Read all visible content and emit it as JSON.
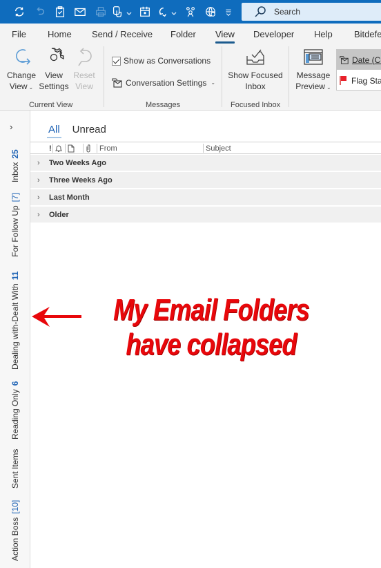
{
  "titlebar": {
    "qat": [
      {
        "name": "send-receive-all-icon",
        "disabled": false
      },
      {
        "name": "undo-icon",
        "disabled": true
      },
      {
        "name": "tasks-icon",
        "disabled": false
      },
      {
        "name": "mail-icon",
        "disabled": false
      },
      {
        "name": "print-icon",
        "disabled": true
      },
      {
        "name": "touch-mode-icon",
        "disabled": false,
        "has_dropdown": true
      },
      {
        "name": "calendar-icon",
        "disabled": false
      },
      {
        "name": "reply-icon",
        "disabled": false,
        "has_dropdown": true
      },
      {
        "name": "people-icon",
        "disabled": false
      },
      {
        "name": "web-icon",
        "disabled": false
      },
      {
        "name": "customize-qat-icon",
        "disabled": false
      }
    ],
    "search_placeholder": "Search"
  },
  "ribbon_tabs": [
    {
      "label": "File",
      "active": false
    },
    {
      "label": "Home",
      "active": false
    },
    {
      "label": "Send / Receive",
      "active": false
    },
    {
      "label": "Folder",
      "active": false
    },
    {
      "label": "View",
      "active": true
    },
    {
      "label": "Developer",
      "active": false
    },
    {
      "label": "Help",
      "active": false
    },
    {
      "label": "Bitdefe",
      "active": false
    }
  ],
  "ribbon": {
    "current_view": {
      "label": "Current View",
      "change_view": {
        "line1": "Change",
        "line2": "View"
      },
      "view_settings": {
        "line1": "View",
        "line2": "Settings"
      },
      "reset_view": {
        "line1": "Reset",
        "line2": "View",
        "disabled": true
      }
    },
    "messages": {
      "label": "Messages",
      "show_as_conversations": {
        "label": "Show as Conversations",
        "checked": true
      },
      "conversation_settings": {
        "label": "Conversation Settings"
      }
    },
    "focused_inbox": {
      "label": "Focused Inbox",
      "show_focused": {
        "line1": "Show Focused",
        "line2": "Inbox"
      }
    },
    "layout": {
      "message_preview": {
        "line1": "Message",
        "line2": "Preview"
      }
    },
    "arrangement": {
      "items": [
        {
          "label": "Date (Co",
          "selected": true
        },
        {
          "label": "Flag Sta",
          "selected": false
        }
      ]
    }
  },
  "folder_pane": {
    "collapsed": true,
    "folders": [
      {
        "name": "Inbox",
        "count": "25",
        "count_style": "bold"
      },
      {
        "name": "For Follow Up",
        "count": "[7]",
        "count_style": "bracket"
      },
      {
        "name": "Dealing with-Dealt With",
        "count": "11",
        "count_style": "bold"
      },
      {
        "name": "Reading Only",
        "count": "6",
        "count_style": "bold"
      },
      {
        "name": "Sent Items",
        "count": "",
        "count_style": "none"
      },
      {
        "name": "Action Boss",
        "count": "[10]",
        "count_style": "bracket"
      }
    ]
  },
  "message_list": {
    "filter_tabs": [
      {
        "label": "All",
        "active": true
      },
      {
        "label": "Unread",
        "active": false
      }
    ],
    "columns": {
      "importance": "!",
      "reminder": "reminder-icon",
      "icon": "document-icon",
      "attachment": "paperclip-icon",
      "from": "From",
      "subject": "Subject"
    },
    "groups": [
      {
        "label": "Two Weeks Ago"
      },
      {
        "label": "Three Weeks Ago"
      },
      {
        "label": "Last Month"
      },
      {
        "label": "Older"
      }
    ]
  },
  "annotation": {
    "line1": "My Email Folders",
    "line2": "have collapsed",
    "color": "#e8070b"
  },
  "colors": {
    "titlebar": "#0f6cbd",
    "accent": "#1e63b5",
    "ribbon_bg": "#f3f3f3"
  }
}
